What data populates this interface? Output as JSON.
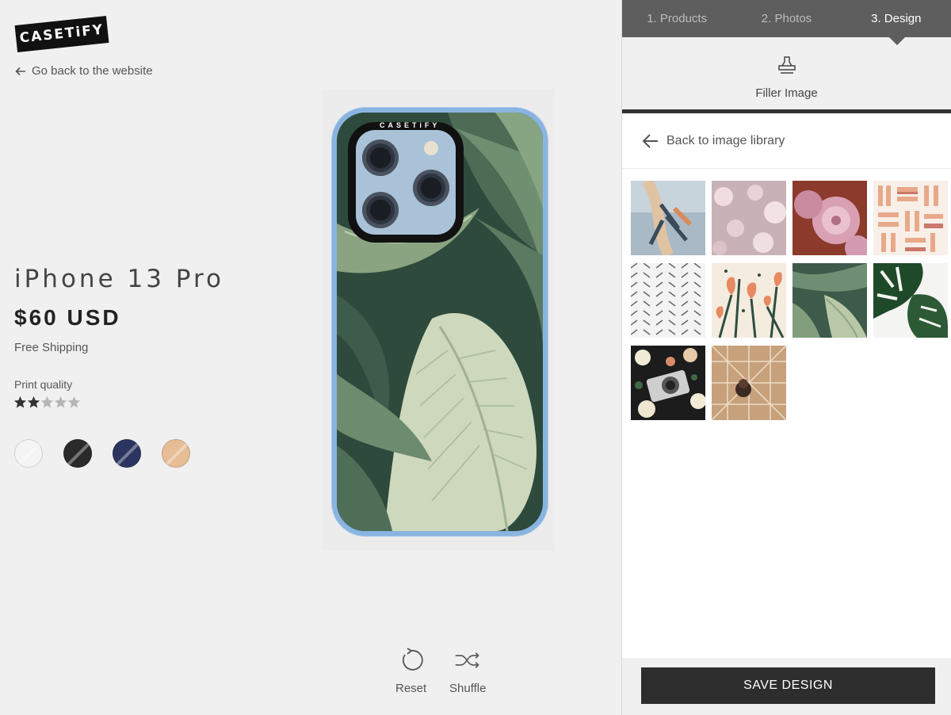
{
  "brand": {
    "logo_text": "CASETiFY"
  },
  "nav": {
    "back_label": "Go back to the website"
  },
  "product": {
    "title": "iPhone 13 Pro",
    "price": "$60 USD",
    "shipping": "Free Shipping",
    "print_quality_label": "Print quality",
    "print_quality_rating": 2,
    "print_quality_max": 5,
    "swatches": [
      {
        "name": "clear",
        "color": "#f4f4f4"
      },
      {
        "name": "black",
        "color": "#2a2a2a"
      },
      {
        "name": "navy",
        "color": "#2b3560"
      },
      {
        "name": "peach",
        "color": "#e6bd94"
      }
    ]
  },
  "case_print": {
    "camera_text": "CASETiFY"
  },
  "controls": {
    "reset_label": "Reset",
    "shuffle_label": "Shuffle"
  },
  "panel": {
    "steps": [
      "1. Products",
      "2. Photos",
      "3. Design"
    ],
    "active_step": 2,
    "filler_label": "Filler Image",
    "back_library_label": "Back to image library",
    "thumbnails": [
      "feather-hanging",
      "bokeh-lights",
      "pink-flowers",
      "geometric-strokes",
      "herringbone-pattern",
      "orange-floral",
      "banana-leaves",
      "monstera-leaves",
      "camera-floral",
      "golden-pattern"
    ],
    "save_label": "SAVE DESIGN"
  }
}
